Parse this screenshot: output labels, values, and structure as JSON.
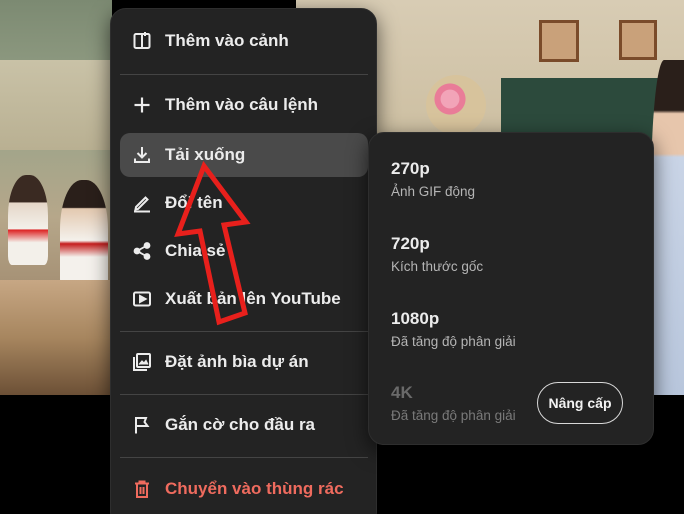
{
  "menu": {
    "items": [
      {
        "label": "Thêm vào cảnh",
        "icon": "add-to-scene-icon"
      },
      {
        "label": "Thêm vào câu lệnh",
        "icon": "plus-icon"
      },
      {
        "label": "Tải xuống",
        "icon": "download-icon"
      },
      {
        "label": "Đổi tên",
        "icon": "pencil-icon"
      },
      {
        "label": "Chia sẻ",
        "icon": "share-icon"
      },
      {
        "label": "Xuất bản lên YouTube",
        "icon": "youtube-play-icon"
      },
      {
        "label": "Đặt ảnh bìa dự án",
        "icon": "image-gallery-icon"
      },
      {
        "label": "Gắn cờ cho đầu ra",
        "icon": "flag-icon"
      },
      {
        "label": "Chuyển vào thùng rác",
        "icon": "trash-icon"
      }
    ]
  },
  "download_submenu": {
    "options": [
      {
        "quality": "270p",
        "desc": "Ảnh GIF động"
      },
      {
        "quality": "720p",
        "desc": "Kích thước gốc"
      },
      {
        "quality": "1080p",
        "desc": "Đã tăng độ phân giải"
      },
      {
        "quality": "4K",
        "desc": "Đã tăng độ phân giải"
      }
    ],
    "upgrade_label": "Nâng cấp"
  },
  "colors": {
    "menu_bg": "#232323",
    "active_bg": "#4a4a4a",
    "danger": "#ef6b5e",
    "annotation_arrow": "#e8201c"
  }
}
